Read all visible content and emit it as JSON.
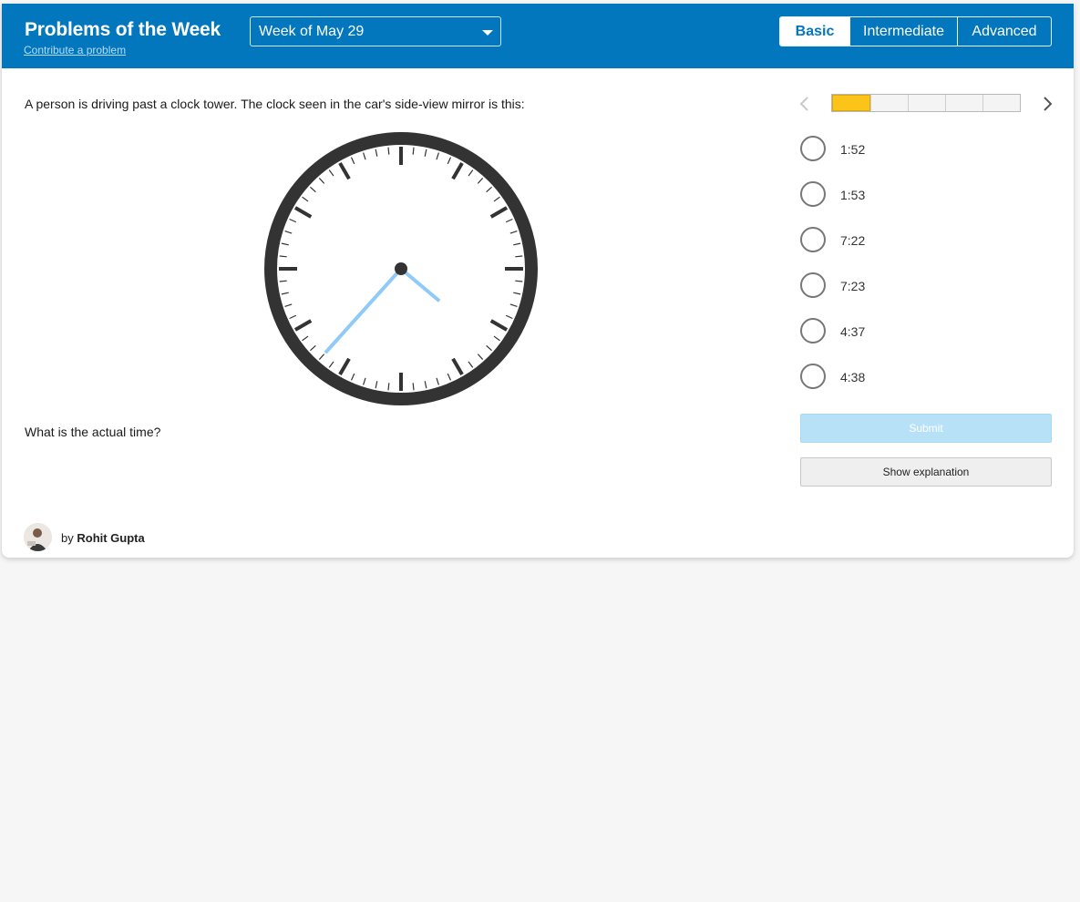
{
  "header": {
    "title": "Problems of the Week",
    "contribute_link": "Contribute a problem",
    "week_select": {
      "selected": "Week of May 29"
    },
    "levels": [
      {
        "label": "Basic",
        "active": true
      },
      {
        "label": "Intermediate",
        "active": false
      },
      {
        "label": "Advanced",
        "active": false
      }
    ]
  },
  "problem": {
    "question": "A person is driving past a clock tower. The clock seen in the car's side-view mirror is this:",
    "prompt": "What is the actual time?",
    "clock": {
      "hour_hand_deg": 130,
      "minute_hand_deg": 222,
      "hand_color": "#90caf9",
      "face_color": "#333333"
    }
  },
  "navigation": {
    "prev_icon": "chevron-left-icon",
    "next_icon": "chevron-right-icon",
    "progress": {
      "current": 1,
      "total": 5,
      "fill_color": "#fcc419"
    }
  },
  "answers": {
    "options": [
      "1:52",
      "1:53",
      "7:22",
      "7:23",
      "4:37",
      "4:38"
    ],
    "submit_label": "Submit",
    "explanation_label": "Show explanation"
  },
  "author": {
    "by": "by",
    "name": "Rohit Gupta"
  }
}
